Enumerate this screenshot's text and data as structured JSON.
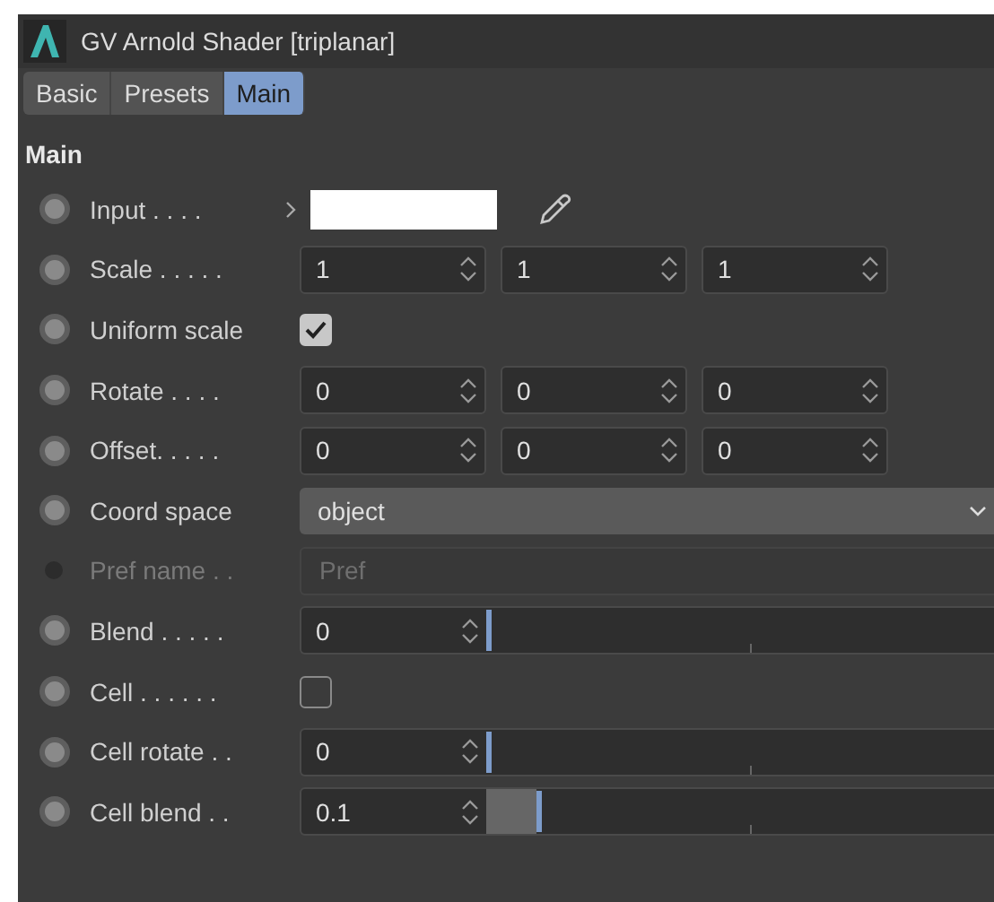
{
  "window": {
    "title": "GV Arnold Shader [triplanar]"
  },
  "tabs": [
    {
      "label": "Basic",
      "selected": false
    },
    {
      "label": "Presets",
      "selected": false
    },
    {
      "label": "Main",
      "selected": true
    }
  ],
  "section": {
    "title": "Main"
  },
  "params": [
    {
      "kind": "color",
      "label": "Input . . . .",
      "disabled": false,
      "color": "#ffffff"
    },
    {
      "kind": "vector",
      "label": "Scale . . . . .",
      "disabled": false,
      "values": [
        "1",
        "1",
        "1"
      ]
    },
    {
      "kind": "checkbox",
      "label": "Uniform scale",
      "disabled": false,
      "checked": true
    },
    {
      "kind": "vector",
      "label": "Rotate . . . .",
      "disabled": false,
      "values": [
        "0",
        "0",
        "0"
      ]
    },
    {
      "kind": "vector",
      "label": "Offset. . . . .",
      "disabled": false,
      "values": [
        "0",
        "0",
        "0"
      ]
    },
    {
      "kind": "dropdown",
      "label": "Coord space",
      "disabled": false,
      "value": "object"
    },
    {
      "kind": "text",
      "label": "Pref name . .",
      "disabled": true,
      "value": "Pref"
    },
    {
      "kind": "slider",
      "label": "Blend . . . . .",
      "disabled": false,
      "value": "0",
      "level": 0
    },
    {
      "kind": "checkbox",
      "label": "Cell . . . . . .",
      "disabled": false,
      "checked": false
    },
    {
      "kind": "slider",
      "label": "Cell rotate . .",
      "disabled": false,
      "value": "0",
      "level": 0
    },
    {
      "kind": "slider",
      "label": "Cell blend . .",
      "disabled": false,
      "value": "0.1",
      "level": 0.1
    }
  ]
}
